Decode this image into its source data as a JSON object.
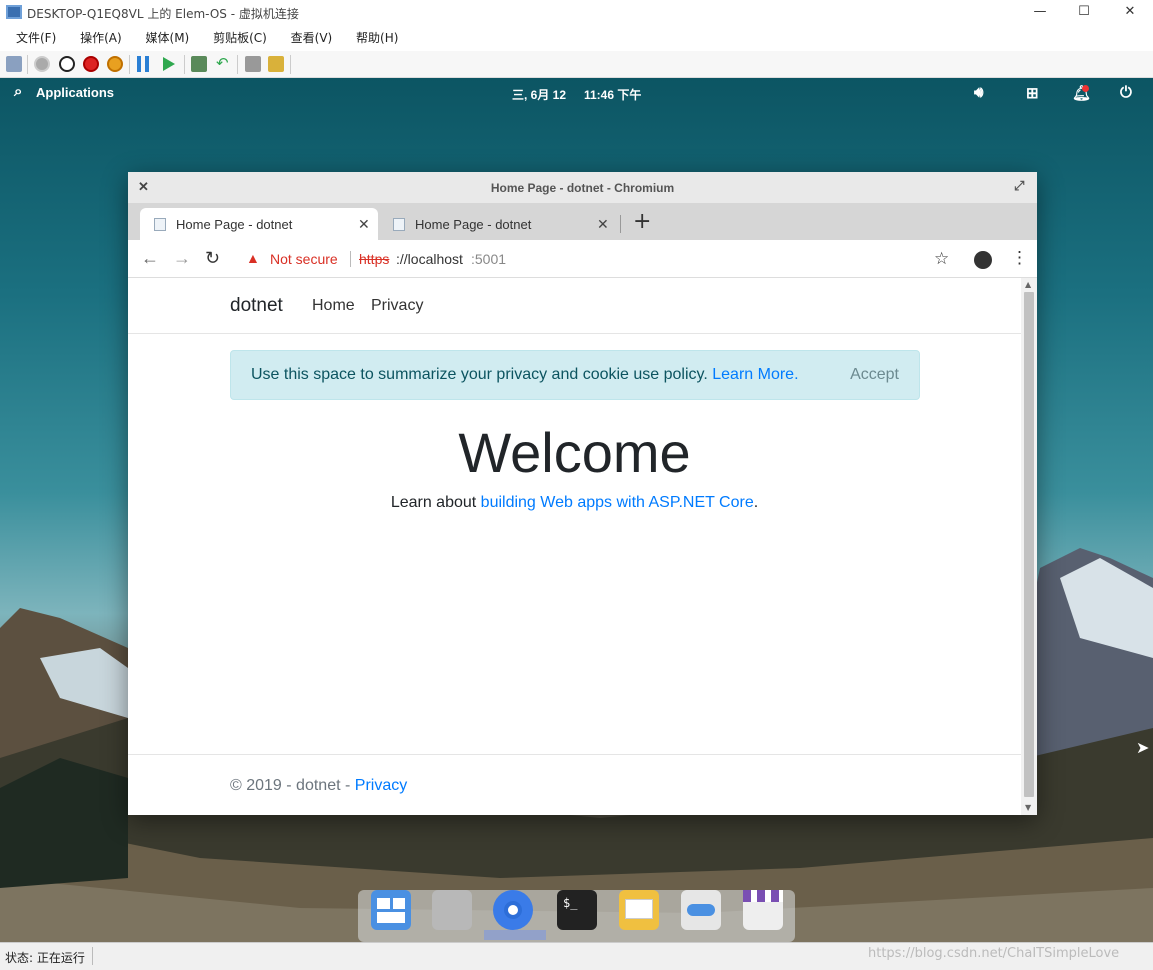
{
  "host": {
    "title": "DESKTOP-Q1EQ8VL 上的 Elem-OS - 虚拟机连接",
    "window_controls": [
      "—",
      "☐",
      "✕"
    ],
    "menu": [
      "文件(F)",
      "操作(A)",
      "媒体(M)",
      "剪贴板(C)",
      "查看(V)",
      "帮助(H)"
    ],
    "status": "状态: 正在运行",
    "watermark": "https://blog.csdn.net/ChaITSimpleLove"
  },
  "topbar": {
    "applications": "Applications",
    "date": "三, 6月 12",
    "time": "11:46 下午"
  },
  "browser": {
    "window_title": "Home Page - dotnet - Chromium",
    "tabs": [
      {
        "label": "Home Page - dotnet",
        "active": true
      },
      {
        "label": "Home Page - dotnet",
        "active": false
      }
    ],
    "security": "Not secure",
    "url_scheme": "https",
    "url_rest": "://localhost",
    "url_port": ":5001"
  },
  "page": {
    "brand": "dotnet",
    "nav": [
      "Home",
      "Privacy"
    ],
    "cookie_text": "Use this space to summarize your privacy and cookie use policy.",
    "cookie_link": "Learn More.",
    "accept": "Accept",
    "heading": "Welcome",
    "learn_prefix": "Learn about",
    "learn_link": "building Web apps with ASP.NET Core",
    "learn_suffix": ".",
    "footer_text": "© 2019 - dotnet -",
    "footer_link": "Privacy"
  },
  "dock_apps": [
    "multitasking-view-icon",
    "files-icon",
    "chromium-icon",
    "terminal-icon",
    "mail-icon",
    "settings-icon",
    "appcenter-icon"
  ]
}
